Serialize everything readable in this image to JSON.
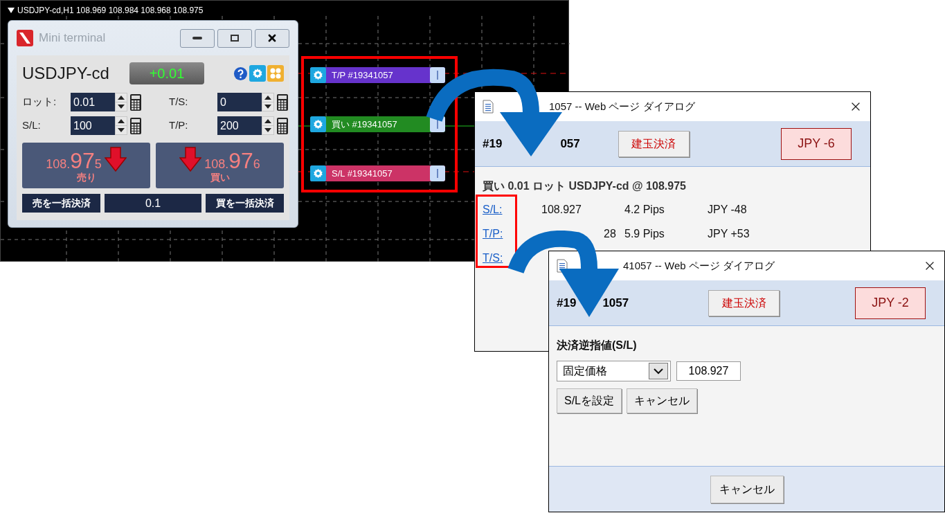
{
  "chart": {
    "header": "USDJPY-cd,H1 108.969 108.984 108.968 108.975",
    "mini_terminal": {
      "title": "Mini terminal",
      "symbol": "USDJPY-cd",
      "change": "+0.01",
      "fields": [
        {
          "label": "ロット:",
          "value": "0.01"
        },
        {
          "label": "T/S:",
          "value": "0"
        },
        {
          "label": "S/L:",
          "value": "100"
        },
        {
          "label": "T/P:",
          "value": "200"
        }
      ],
      "sell": {
        "price_head": "108.",
        "price_big": "97",
        "price_tail": "5",
        "label": "売り"
      },
      "buy": {
        "price_head": "108.",
        "price_big": "97",
        "price_tail": "6",
        "label": "買い"
      },
      "close_sell": "売を一括決済",
      "volume": "0.1",
      "close_buy": "買を一括決済"
    },
    "order_lines": [
      {
        "label": "T/P #19341057",
        "color": "#6633cc"
      },
      {
        "label": "買い #19341057",
        "color": "#228b22"
      },
      {
        "label": "S/L #19341057",
        "color": "#cc3366"
      }
    ]
  },
  "dialogs": [
    {
      "kind": "order",
      "title": "1057 -- Web ページ ダイアログ",
      "order_number_parts": [
        "#19",
        "057"
      ],
      "close_position_button": "建玉決済",
      "profit": "JPY -6",
      "summary": "買い 0.01 ロット USDJPY-cd @ 108.975",
      "rows": [
        {
          "link": "S/L:",
          "price": "108.927",
          "pips": "4.2 Pips",
          "amount": "JPY -48"
        },
        {
          "link": "T/P:",
          "price": "28",
          "pips": "5.9 Pips",
          "amount": "JPY +53"
        },
        {
          "link": "T/S:"
        }
      ]
    },
    {
      "kind": "stop_loss",
      "title": "41057 -- Web ページ ダイアログ",
      "order_number_parts": [
        "#19",
        "1057"
      ],
      "close_position_button": "建玉決済",
      "profit": "JPY -2",
      "section_title": "決済逆指値(S/L)",
      "mode_select": "固定価格",
      "price_input": "108.927",
      "buttons": [
        "S/Lを設定",
        "キャンセル"
      ],
      "footer_button": "キャンセル"
    }
  ]
}
